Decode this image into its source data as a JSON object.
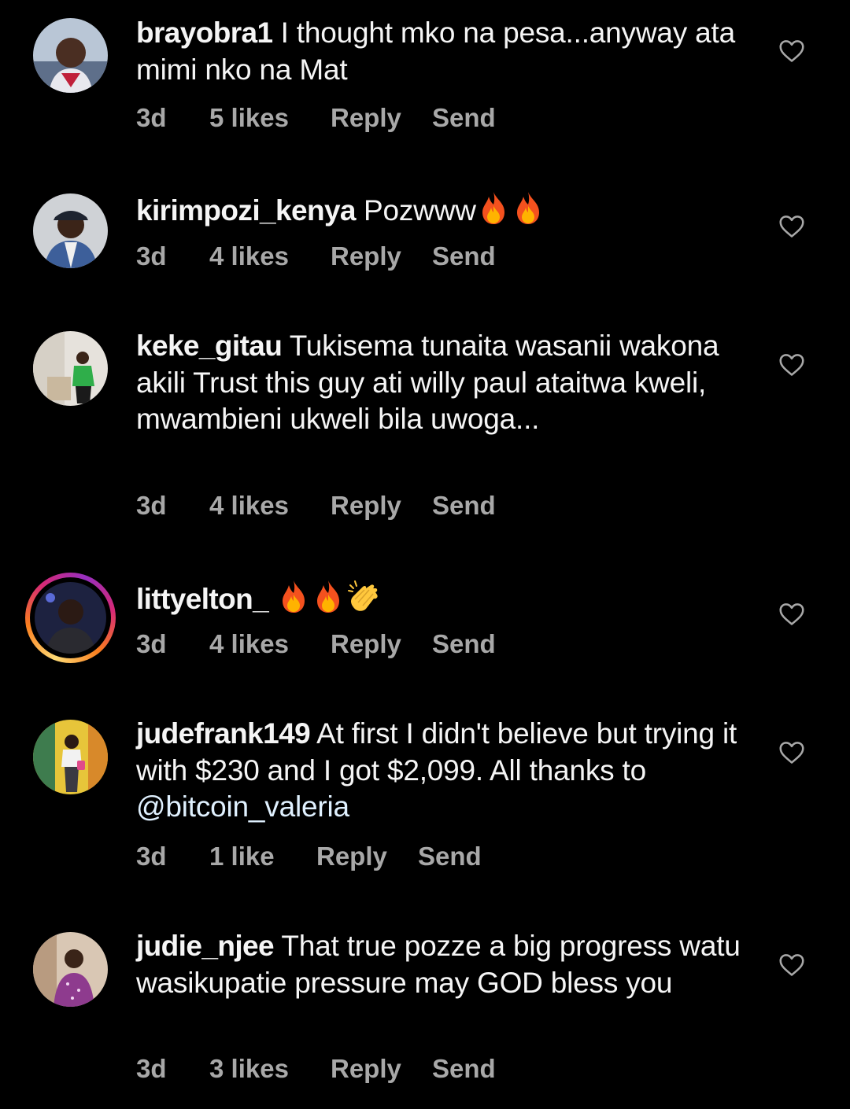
{
  "comments": [
    {
      "username": "brayobra1",
      "text": "I thought mko na pesa...anyway ata mimi nko na Mat",
      "time": "3d",
      "likes": "5 likes",
      "reply": "Reply",
      "send": "Send"
    },
    {
      "username": "kirimpozi_kenya",
      "text": "Pozwww",
      "emojis": [
        "fire",
        "fire"
      ],
      "time": "3d",
      "likes": "4 likes",
      "reply": "Reply",
      "send": "Send"
    },
    {
      "username": "keke_gitau",
      "text": "Tukisema tunaita wasanii wakona akili Trust this guy ati willy paul ataitwa kweli, mwambieni ukweli bila uwoga...",
      "time": "3d",
      "likes": "4 likes",
      "reply": "Reply",
      "send": "Send"
    },
    {
      "username": "littyelton_",
      "text": "",
      "emojis": [
        "fire",
        "fire",
        "clapping-hands"
      ],
      "time": "3d",
      "likes": "4 likes",
      "reply": "Reply",
      "send": "Send",
      "has_story_ring": true
    },
    {
      "username": "judefrank149",
      "text": "At first I didn't believe but trying it with $230 and I got $2,099. All thanks to",
      "mention": "@bitcoin_valeria",
      "time": "3d",
      "likes": "1 like",
      "reply": "Reply",
      "send": "Send"
    },
    {
      "username": "judie_njee",
      "text": "That true pozze a big progress watu wasikupatie pressure may GOD bless you",
      "time": "3d",
      "likes": "3 likes",
      "reply": "Reply",
      "send": "Send"
    }
  ],
  "colors": {
    "background": "#000000",
    "primary_text": "#f5f5f5",
    "secondary_text": "#a8a8a8",
    "mention": "#e0f1ff"
  },
  "icons": {
    "like": "heart-outline-icon",
    "fire": "fire-emoji",
    "clap": "clapping-hands-emoji"
  }
}
